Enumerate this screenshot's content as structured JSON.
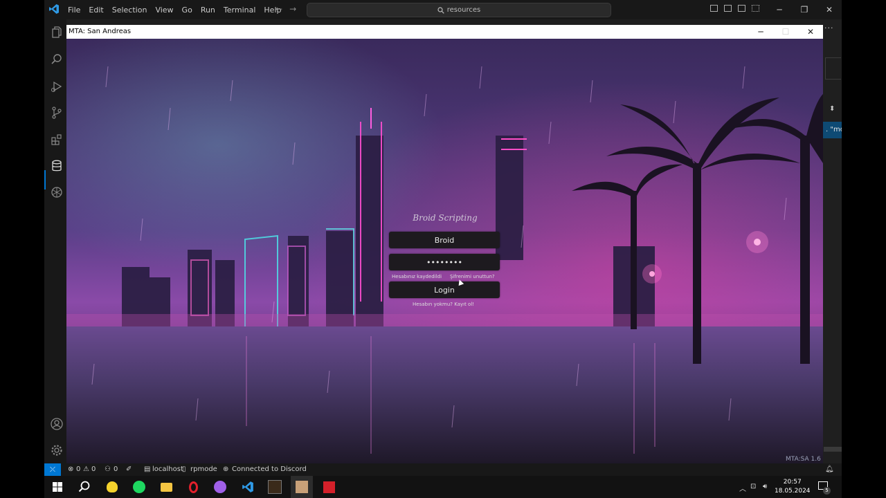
{
  "vscode": {
    "menu": [
      "File",
      "Edit",
      "Selection",
      "View",
      "Go",
      "Run",
      "Terminal",
      "Help"
    ],
    "search_text": "resources",
    "snippet_text": ". \"mo",
    "accent": "#0078d4"
  },
  "mta_window": {
    "title": "MTA: San Andreas",
    "version": "MTA:SA 1.6"
  },
  "login": {
    "brand": "Broid Scripting",
    "username_value": "Broid",
    "password_value": "••••••••",
    "remember_label": "Hesabınız kaydedildi",
    "forgot_label": "Şifrenimi unuttun?",
    "login_button": "Login",
    "register_label": "Hesabın yokmu? Kayıt ol!"
  },
  "status_bar": {
    "errors": "0",
    "warnings": "0",
    "ports": "0",
    "db_host": "localhost",
    "db_name": "rpmode",
    "discord": "Connected to Discord"
  },
  "taskbar": {
    "time": "20:57",
    "date": "18.05.2024",
    "notifications": "5",
    "icons": [
      "windows-start-icon",
      "search-icon",
      "pikachu-app-icon",
      "spotify-icon",
      "file-explorer-icon",
      "opera-icon",
      "discord-icon",
      "vscode-icon",
      "game-app-icon",
      "mta-app-icon",
      "amd-icon"
    ]
  }
}
